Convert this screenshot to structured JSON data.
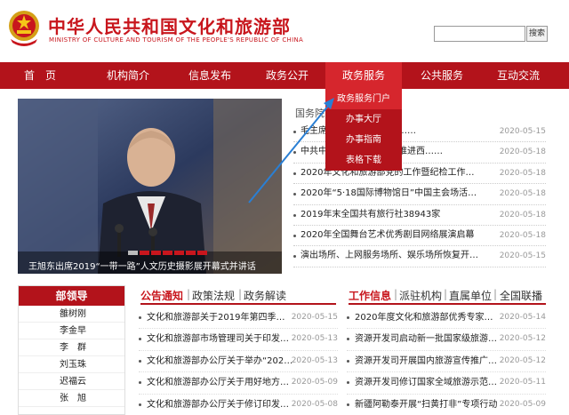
{
  "header": {
    "title_cn": "中华人民共和国文化和旅游部",
    "title_en": "MINISTRY OF CULTURE AND TOURISM OF THE PEOPLE'S REPUBLIC OF CHINA",
    "search_placeholder": "",
    "search_button": "搜索",
    "brand_color": "#c8161d"
  },
  "nav": {
    "items": [
      "首　页",
      "机构简介",
      "信息发布",
      "政务公开",
      "政务服务",
      "公共服务",
      "互动交流"
    ],
    "active_index": 4
  },
  "dropdown": {
    "items": [
      "政务服务门户",
      "办事大厅",
      "办事指南",
      "表格下载"
    ]
  },
  "slider": {
    "caption": "王旭东出席2019“一带一路”人文历史摄影展开幕式并讲话",
    "slides_total": 7,
    "current_slide": 1
  },
  "news": {
    "head": "国务院",
    "items": [
      {
        "title": "毛主席……习近平总书记……",
        "date": "2020-05-15"
      },
      {
        "title": "中共中央……关于新时代推进西……",
        "date": "2020-05-18"
      },
      {
        "title": "2020年文化和旅游部党的工作暨纪检工作会议召开",
        "date": "2020-05-18"
      },
      {
        "title": "2020年“5·18国际博物馆日”中国主会场活动……",
        "date": "2020-05-18"
      },
      {
        "title": "2019年末全国共有旅行社38943家",
        "date": "2020-05-18"
      },
      {
        "title": "2020年全国舞台艺术优秀剧目网络展演启幕",
        "date": "2020-05-18"
      },
      {
        "title": "演出场所、上网服务场所、娱乐场所恢复开放……",
        "date": "2020-05-15"
      }
    ]
  },
  "leaders": {
    "head": "部领导",
    "names": [
      "雒树刚",
      "李金早",
      "李　群",
      "刘玉珠",
      "迟福云",
      "张　旭"
    ]
  },
  "mid_tabs": {
    "labels": [
      "公告通知",
      "政策法规",
      "政务解读"
    ],
    "separator": "|"
  },
  "mid_list": [
    {
      "title": "文化和旅游部关于2019年第四季度全……",
      "date": "2020-05-15"
    },
    {
      "title": "文化和旅游部市场管理司关于印发《剧……",
      "date": "2020-05-13"
    },
    {
      "title": "文化和旅游部办公厅关于举办“2020……",
      "date": "2020-05-13"
    },
    {
      "title": "文化和旅游部办公厅关于用好地方政府……",
      "date": "2020-05-09"
    },
    {
      "title": "文化和旅游部办公厅关于修订印发《国……",
      "date": "2020-05-08"
    }
  ],
  "right_tabs": {
    "labels": [
      "工作信息",
      "派驻机构",
      "直属单位",
      "全国联播"
    ],
    "separator": "|"
  },
  "right_list": [
    {
      "title": "2020年度文化和旅游部优秀专家推荐……",
      "date": "2020-05-14"
    },
    {
      "title": "资源开发司启动新一批国家级旅游度假……",
      "date": "2020-05-12"
    },
    {
      "title": "资源开发司开展国内旅游宣传推广典型……",
      "date": "2020-05-12"
    },
    {
      "title": "资源开发司修订国家全域旅游示范区验……",
      "date": "2020-05-11"
    },
    {
      "title": "新疆阿勒泰开展“扫黄打非”专项行动",
      "date": "2020-05-09"
    }
  ]
}
